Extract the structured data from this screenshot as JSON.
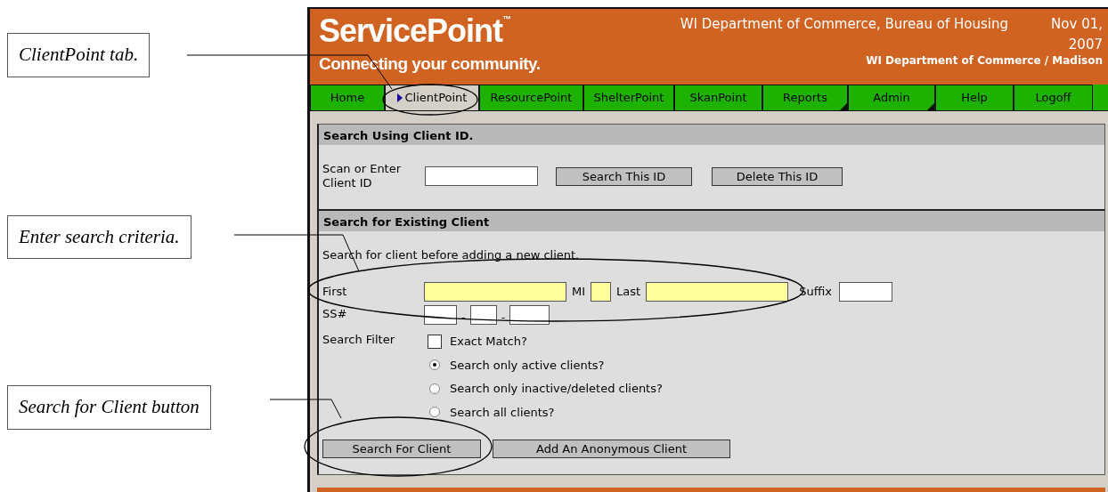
{
  "callouts": [
    {
      "text": "ClientPoint tab."
    },
    {
      "text": "Enter search criteria."
    },
    {
      "text": "Search for Client button"
    }
  ],
  "header": {
    "logo": "ServicePoint",
    "trademark": "™",
    "tagline": "Connecting your community.",
    "agency": "WI Department of Commerce, Bureau of Housing",
    "date": "Nov 01, 2007",
    "location": "WI Department of Commerce / Madison"
  },
  "tabs": [
    {
      "label": "Home",
      "selected": false,
      "has_menu": false
    },
    {
      "label": "ClientPoint",
      "selected": true,
      "has_menu": false
    },
    {
      "label": "ResourcePoint",
      "selected": false,
      "has_menu": false
    },
    {
      "label": "ShelterPoint",
      "selected": false,
      "has_menu": false
    },
    {
      "label": "SkanPoint",
      "selected": false,
      "has_menu": false
    },
    {
      "label": "Reports",
      "selected": false,
      "has_menu": true
    },
    {
      "label": "Admin",
      "selected": false,
      "has_menu": true
    },
    {
      "label": "Help",
      "selected": false,
      "has_menu": false
    },
    {
      "label": "Logoff",
      "selected": false,
      "has_menu": false
    }
  ],
  "id_search": {
    "title": "Search Using Client ID.",
    "label": "Scan or Enter Client ID",
    "buttons": [
      "Search This ID",
      "Delete This ID"
    ]
  },
  "client_search": {
    "title": "Search for Existing Client",
    "intro": "Search for client before adding a new client.",
    "name_fields": [
      {
        "label": "First",
        "required": true
      },
      {
        "label": "MI",
        "required": true
      },
      {
        "label": "Last",
        "required": true
      },
      {
        "label": "Suffix",
        "required": false
      }
    ],
    "ssn_label": "SS#",
    "ssn_separator": "-",
    "filter_label": "Search Filter",
    "filters": [
      {
        "kind": "checkbox",
        "label": "Exact Match?",
        "checked": false
      },
      {
        "kind": "radio",
        "label": "Search only active clients?",
        "selected": true
      },
      {
        "kind": "radio",
        "label": "Search only inactive/deleted clients?",
        "selected": false
      },
      {
        "kind": "radio",
        "label": "Search all clients?",
        "selected": false
      }
    ],
    "buttons": [
      "Search For Client",
      "Add An Anonymous Client"
    ]
  }
}
